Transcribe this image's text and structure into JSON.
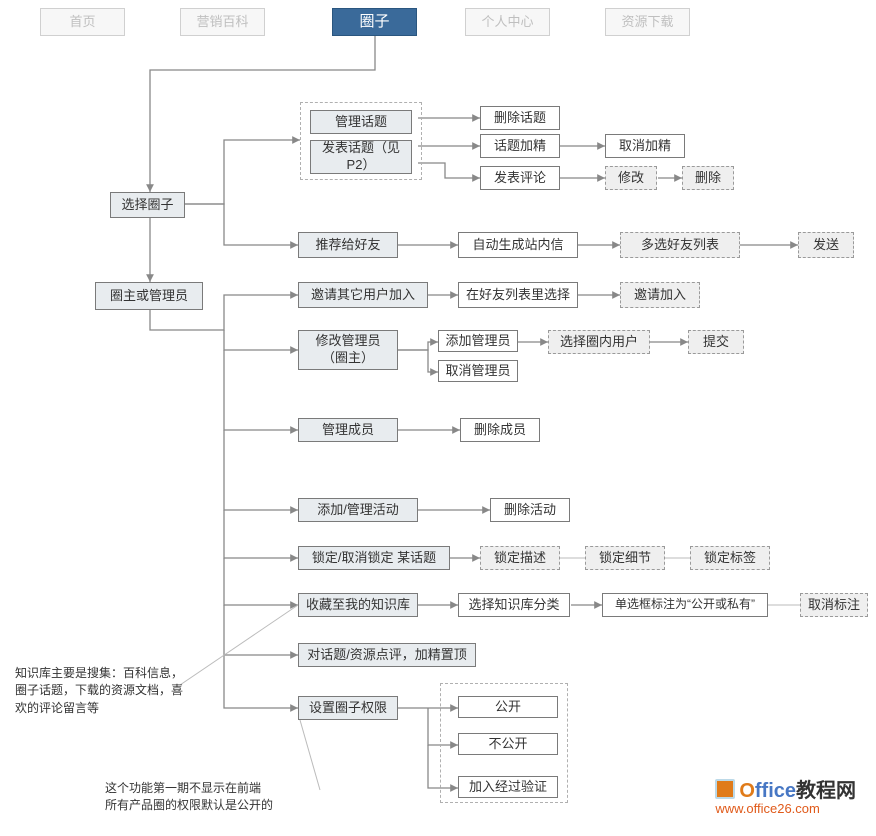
{
  "nav": {
    "home": "首页",
    "wiki": "营销百科",
    "circle": "圈子",
    "profile": "个人中心",
    "download": "资源下载"
  },
  "l1": {
    "selectCircle": "选择圈子",
    "ownerAdmin": "圈主或管理员"
  },
  "topic": {
    "manage": "管理话题",
    "post": "发表话题（见P2）",
    "delete": "删除话题",
    "highlight": "话题加精",
    "unhighlight": "取消加精",
    "comment": "发表评论",
    "edit": "修改",
    "del2": "删除"
  },
  "friend": {
    "recommend": "推荐给好友",
    "autoMsg": "自动生成站内信",
    "multiSelect": "多选好友列表",
    "send": "发送"
  },
  "invite": {
    "invite": "邀请其它用户加入",
    "choose": "在好友列表里选择",
    "join": "邀请加入"
  },
  "admin": {
    "modify": "修改管理员（圈主）",
    "add": "添加管理员",
    "remove": "取消管理员",
    "selectUser": "选择圈内用户",
    "submit": "提交"
  },
  "member": {
    "manage": "管理成员",
    "delete": "删除成员"
  },
  "activity": {
    "manage": "添加/管理活动",
    "delete": "删除活动"
  },
  "lock": {
    "action": "锁定/取消锁定 某话题",
    "desc": "锁定描述",
    "detail": "锁定细节",
    "tag": "锁定标签"
  },
  "kb": {
    "collect": "收藏至我的知识库",
    "category": "选择知识库分类",
    "mark": "单选框标注为“公开或私有”",
    "unmark": "取消标注"
  },
  "review": {
    "action": "对话题/资源点评，加精置顶"
  },
  "perm": {
    "set": "设置圈子权限",
    "public": "公开",
    "private": "不公开",
    "verified": "加入经过验证"
  },
  "notes": {
    "kb": "知识库主要是搜集：百科信息，圈子话题，下载的资源文档，喜欢的评论留言等",
    "perm": "这个功能第一期不显示在前端\n所有产品圈的权限默认是公开的"
  },
  "brand": {
    "name1": "O",
    "name2": "ffice",
    "name3": "教程网",
    "url": "www.office26.com"
  }
}
